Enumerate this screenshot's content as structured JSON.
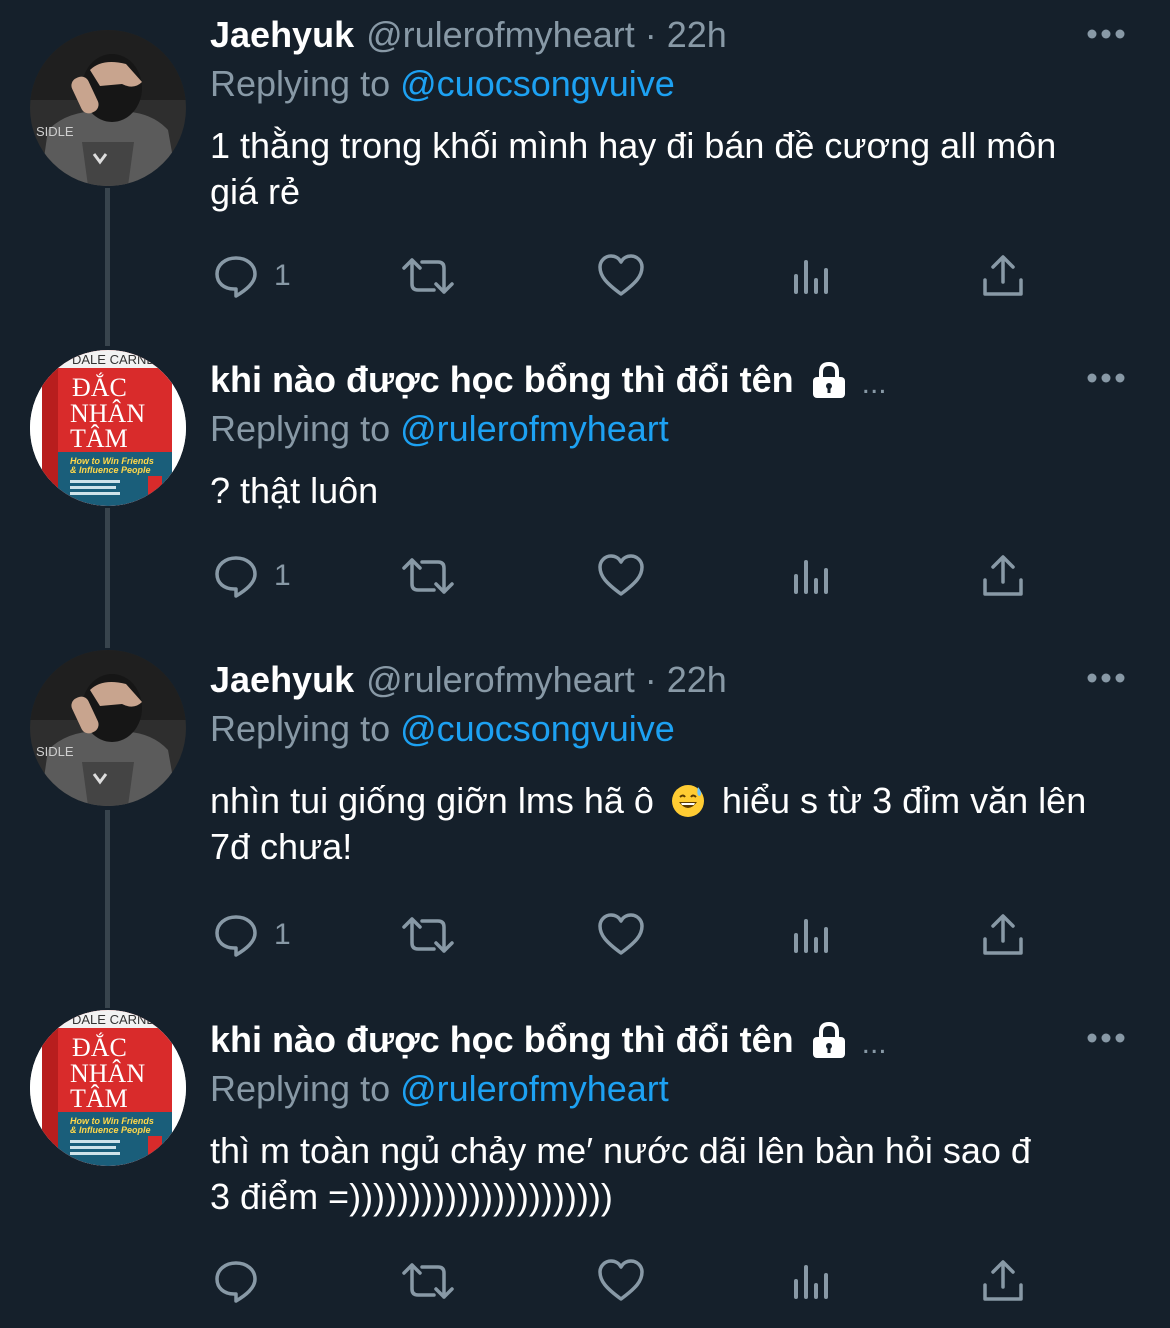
{
  "colors": {
    "background": "#15202b",
    "primary_text": "#ffffff",
    "secondary_text": "#8899a6",
    "link": "#1da1f2",
    "thread_line": "#38444d"
  },
  "tweets": [
    {
      "name": "Jaehyuk",
      "handle": "@rulerofmyheart",
      "dot": "·",
      "time": "22h",
      "replying_prefix": "Replying to",
      "replying_to": "@cuocsongvuive",
      "text_line1": "1 thằng trong khối mình hay đi bán đề cương all môn",
      "text_line2": "giá rẻ",
      "reply_count": "1",
      "avatar": "photo-avatar-icon"
    },
    {
      "name": "khi nào được học bổng thì đổi tên",
      "protected_icon": "lock-icon",
      "truncation": "...",
      "replying_prefix": "Replying to",
      "replying_to": "@rulerofmyheart",
      "text_line1": "? thật luôn",
      "reply_count": "1",
      "avatar": "book-cover-avatar-icon"
    },
    {
      "name": "Jaehyuk",
      "handle": "@rulerofmyheart",
      "dot": "·",
      "time": "22h",
      "replying_prefix": "Replying to",
      "replying_to": "@cuocsongvuive",
      "text_part_a": "nhìn tui giống giỡn lms hã ô",
      "emoji": "grinning-sweat-emoji-icon",
      "text_part_b": "hiểu s từ 3 đỉm văn lên",
      "text_line2": "7đ chưa!",
      "reply_count": "1",
      "avatar": "photo-avatar-icon"
    },
    {
      "name": "khi nào được học bổng thì đổi tên",
      "protected_icon": "lock-icon",
      "truncation": "...",
      "replying_prefix": "Replying to",
      "replying_to": "@rulerofmyheart",
      "text_line1": "thì m toàn ngủ chảy me′ nước dãi lên bàn hỏi sao đ",
      "text_line2": "3 điểm =))))))))))))))))))))))",
      "reply_count": "",
      "avatar": "book-cover-avatar-icon"
    }
  ],
  "book_cover": {
    "author": "DALE CARNEGIE",
    "title_1": "ĐẮC",
    "title_2": "NHÂN",
    "title_3": "TÂM",
    "subtitle_1": "How to Win Friends",
    "subtitle_2": "& Influence People"
  },
  "photo_avatar": {
    "shirt_text": "SIDLE"
  }
}
